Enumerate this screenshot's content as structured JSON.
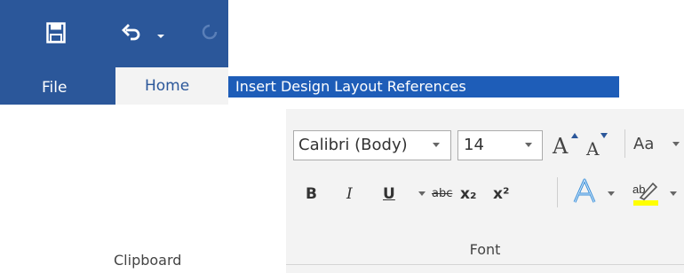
{
  "quick_access": {
    "save_icon": "save-icon",
    "undo_icon": "undo-icon",
    "redo_icon": "redo-icon"
  },
  "tabs": {
    "file": "File",
    "home": "Home",
    "others": "Insert Design Layout References"
  },
  "font_group": {
    "font_name": "Calibri (Body)",
    "font_size": "14",
    "grow_font": "A",
    "shrink_font": "A",
    "change_case": "Aa",
    "bold": "B",
    "italic": "I",
    "underline": "U",
    "strikethrough": "abc",
    "subscript": "x₂",
    "superscript": "x²",
    "label": "Font"
  },
  "clipboard_group": {
    "label": "Clipboard"
  },
  "colors": {
    "title_bar": "#2b579a",
    "tabs_strip": "#1e5db8",
    "ribbon": "#f3f3f3",
    "highlight": "#ffff00"
  }
}
